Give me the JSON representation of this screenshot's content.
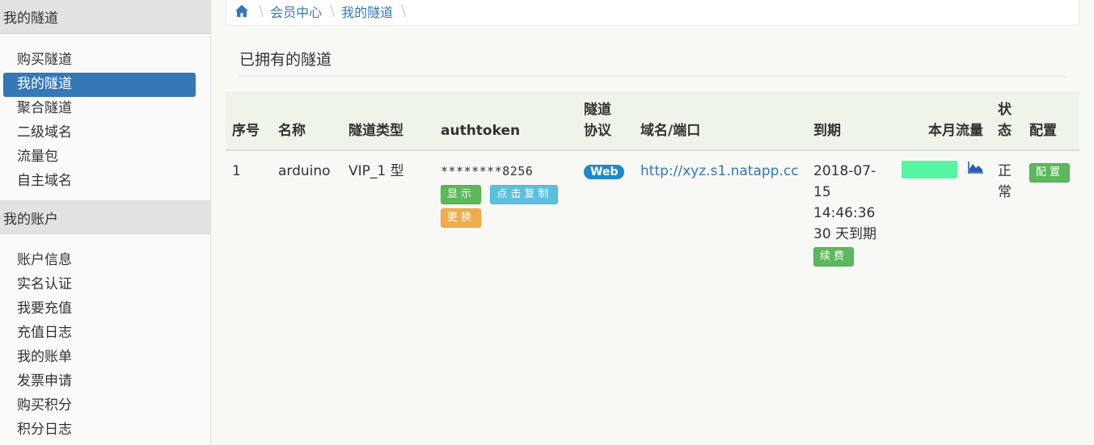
{
  "sidebar": {
    "groups": [
      {
        "title": "我的隧道",
        "items": [
          "购买隧道",
          "我的隧道",
          "聚合隧道",
          "二级域名",
          "流量包",
          "自主域名"
        ]
      },
      {
        "title": "我的账户",
        "items": [
          "账户信息",
          "实名认证",
          "我要充值",
          "充值日志",
          "我的账单",
          "发票申请",
          "购买积分",
          "积分日志"
        ]
      }
    ],
    "active_item": "我的隧道"
  },
  "breadcrumb": {
    "home_icon": "home-icon",
    "items": [
      "会员中心",
      "我的隧道"
    ]
  },
  "page": {
    "title": "已拥有的隧道"
  },
  "table": {
    "headers": [
      "序号",
      "名称",
      "隧道类型",
      "authtoken",
      "隧道协议",
      "域名/端口",
      "到期",
      "本月流量",
      "状态",
      "配置"
    ],
    "rows": [
      {
        "index": "1",
        "name": "arduino",
        "type": "VIP_1 型",
        "authtoken": "********8256",
        "btn_show": "显示",
        "btn_copy": "点击复制",
        "btn_change": "更换",
        "protocol": "Web",
        "domain": "http://xyz.s1.natapp.cc",
        "expire_date": "2018-07-15",
        "expire_time": "14:46:36",
        "expire_remaining": "30 天到期",
        "btn_renew": "续费",
        "traffic_icon": "area-chart-icon",
        "status": "正常",
        "btn_config": "配置"
      }
    ]
  },
  "colors": {
    "active": "#3478b7",
    "green": "#5cb85c",
    "cyan": "#5bc0de",
    "orange": "#f0ad4e",
    "badge": "#1e88c8",
    "traffic": "#55f5a2"
  }
}
